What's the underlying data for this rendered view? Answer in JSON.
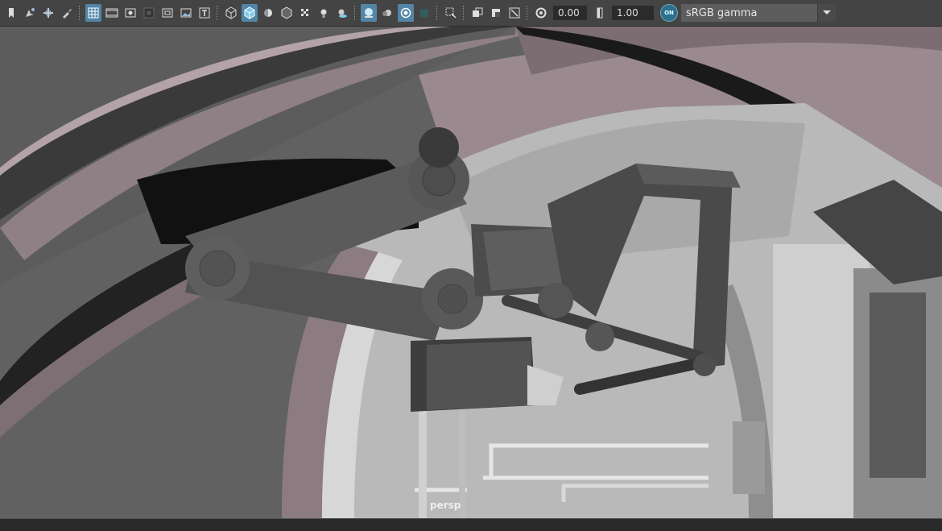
{
  "toolbar": {
    "exposure_value": "0.00",
    "gamma_value": "1.00",
    "color_mgmt_badge": "ON",
    "color_space": "sRGB gamma",
    "icons": [
      "bookmark-icon",
      "select-camera-icon",
      "tumble-icon",
      "brush-icon",
      "grid-icon",
      "film-gate-icon",
      "resolution-gate-icon",
      "gate-mask-icon",
      "field-chart-icon",
      "image-plane-icon",
      "safe-title-icon",
      "wireframe-icon",
      "smooth-shade-icon",
      "default-material-icon",
      "bounding-box-icon",
      "textured-icon",
      "lighting-icon",
      "shadows-icon",
      "screen-space-ao-icon",
      "motion-blur-icon",
      "anti-aliasing-icon",
      "depth-of-field-icon",
      "xray-icon",
      "isolate-select-icon",
      "xray-joints-icon",
      "xray-active-icon",
      "exposure-icon",
      "gamma-icon",
      "color-management-icon"
    ],
    "accent": "#5285a6"
  },
  "viewport": {
    "camera_label": "persp"
  }
}
